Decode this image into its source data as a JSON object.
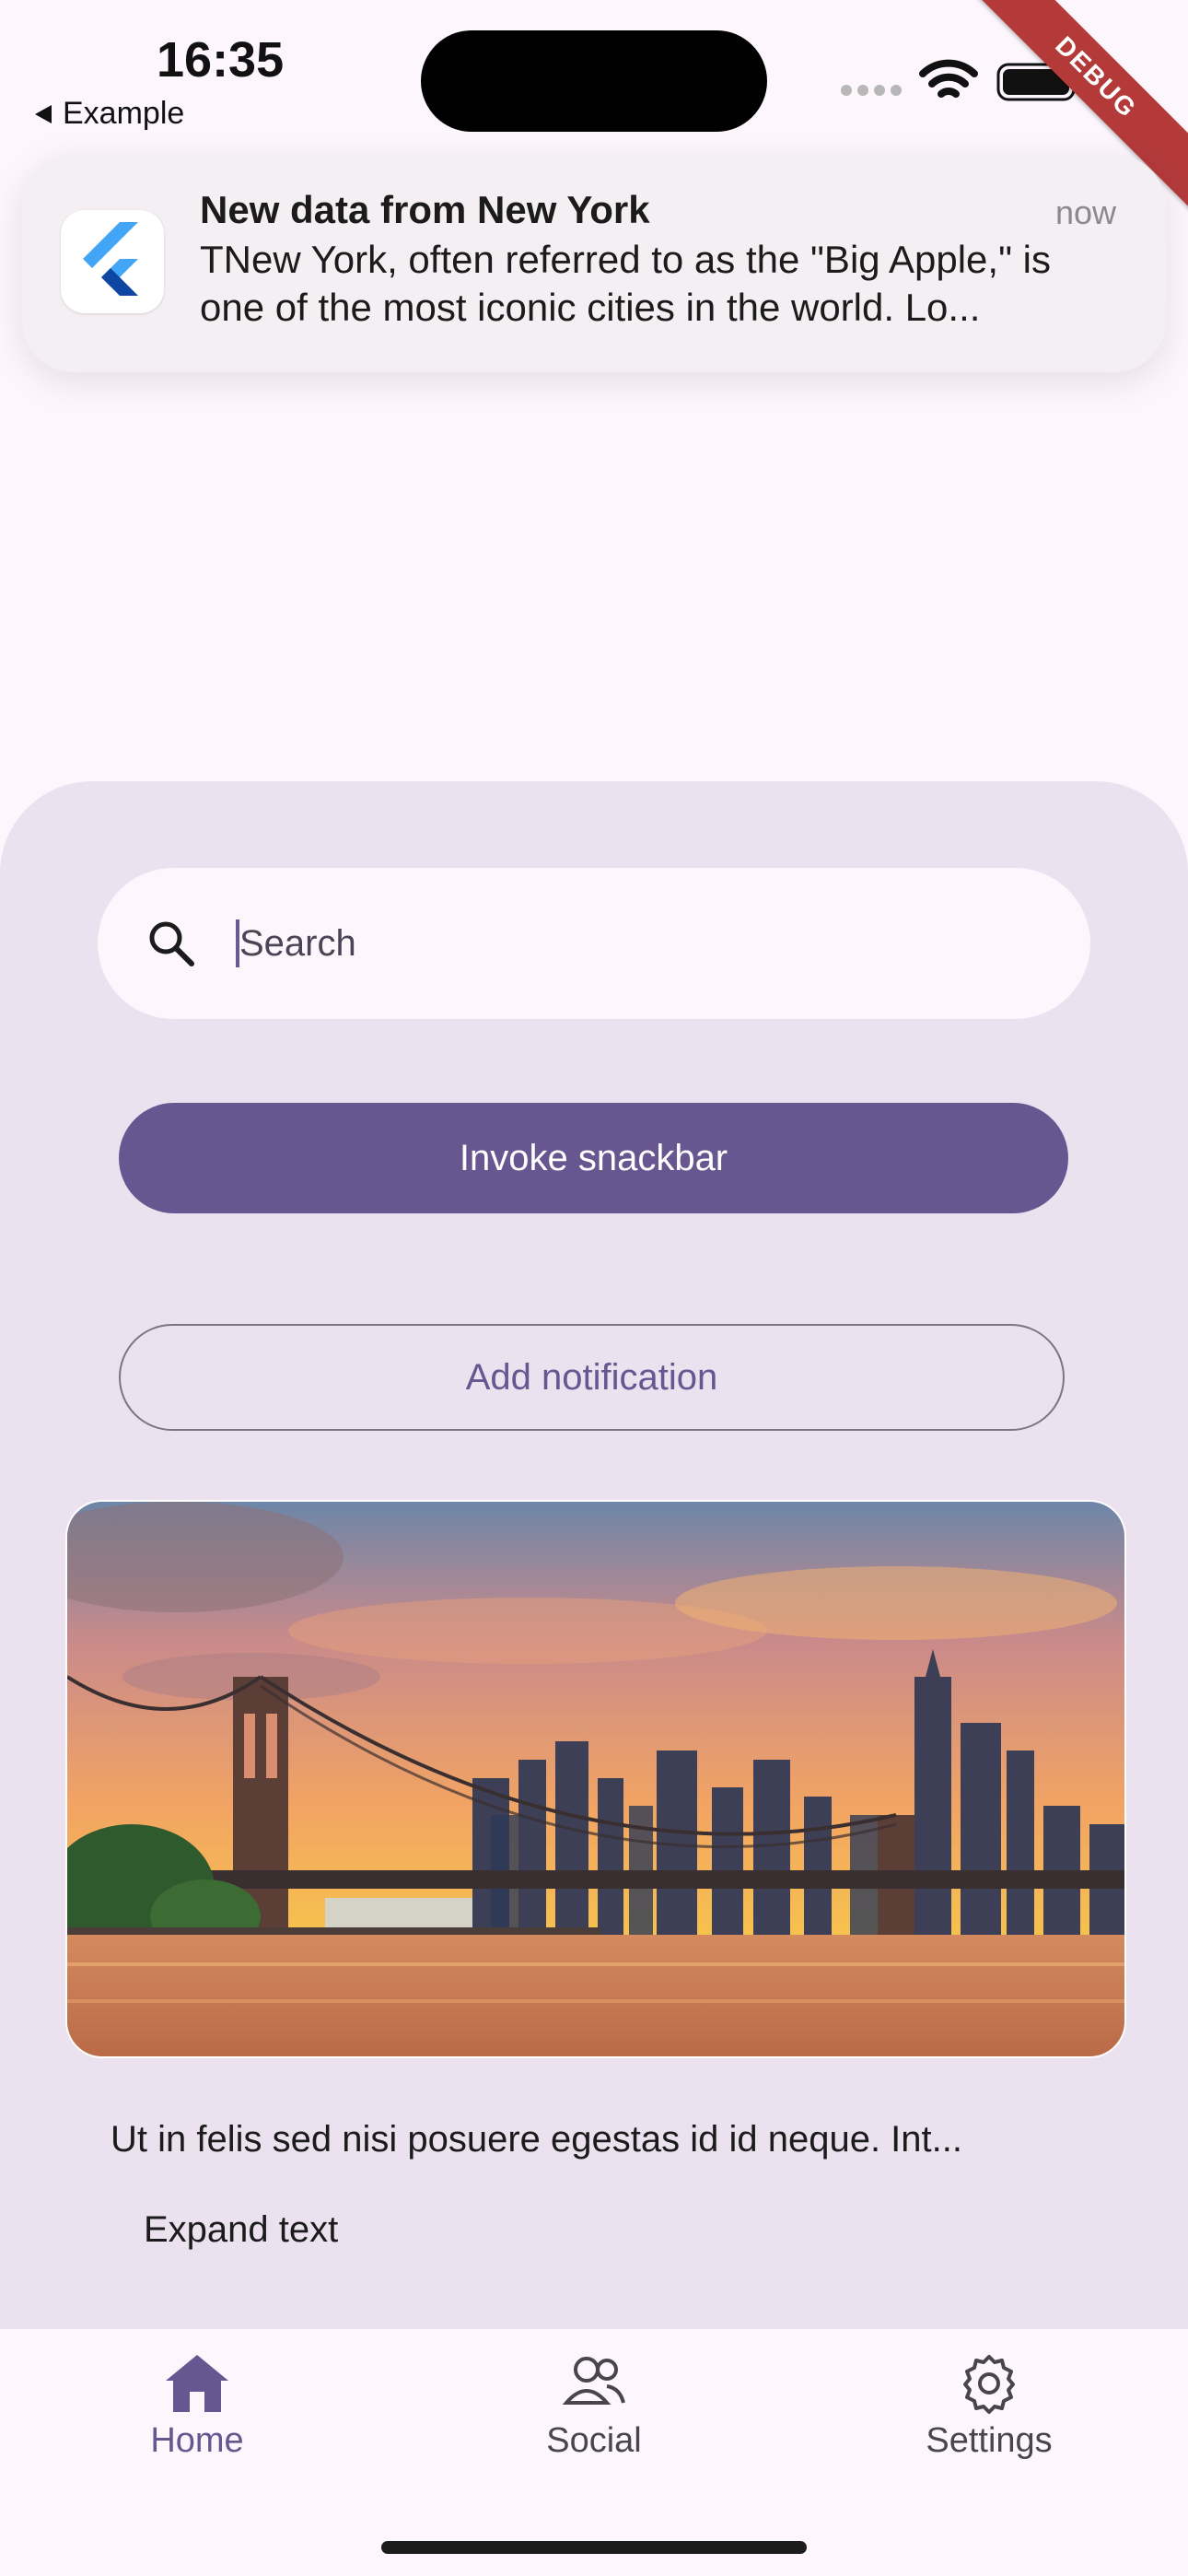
{
  "status_bar": {
    "time": "16:35",
    "back_app": "Example"
  },
  "debug_banner": "DEBUG",
  "notification": {
    "title": "New data from New York",
    "time": "now",
    "body": "TNew York, often referred to as the \"Big Apple,\" is one of the most iconic cities in the world. Lo..."
  },
  "search": {
    "placeholder": "Search"
  },
  "buttons": {
    "invoke_snackbar": "Invoke snackbar",
    "add_notification": "Add notification"
  },
  "content": {
    "paragraph": "Ut in felis sed nisi posuere egestas id id neque. Int...",
    "expand": "Expand text"
  },
  "bottom_nav": {
    "items": [
      {
        "label": "Home",
        "icon": "home-icon",
        "active": true
      },
      {
        "label": "Social",
        "icon": "people-icon",
        "active": false
      },
      {
        "label": "Settings",
        "icon": "gear-icon",
        "active": false
      }
    ]
  },
  "colors": {
    "primary": "#67568f",
    "surface": "#fdf7fd",
    "sheet": "#ebe1ef",
    "debug": "#b43a3a"
  }
}
